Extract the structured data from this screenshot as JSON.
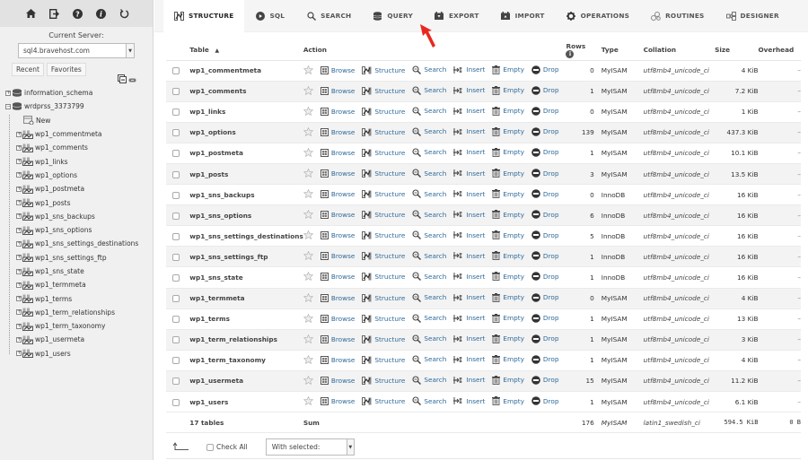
{
  "sidebar": {
    "top_icons": [
      "home-icon",
      "logout-icon",
      "help-icon",
      "info-icon",
      "reload-icon"
    ],
    "server_label": "Current Server:",
    "server_value": "sql4.bravehost.com",
    "recent_label": "Recent",
    "favorites_label": "Favorites",
    "databases": [
      {
        "name": "information_schema",
        "expanded": false
      },
      {
        "name": "wrdprss_3373799",
        "expanded": true
      }
    ],
    "new_label": "New",
    "tables": [
      "wp1_commentmeta",
      "wp1_comments",
      "wp1_links",
      "wp1_options",
      "wp1_postmeta",
      "wp1_posts",
      "wp1_sns_backups",
      "wp1_sns_options",
      "wp1_sns_settings_destinations",
      "wp1_sns_settings_ftp",
      "wp1_sns_state",
      "wp1_termmeta",
      "wp1_terms",
      "wp1_term_relationships",
      "wp1_term_taxonomy",
      "wp1_usermeta",
      "wp1_users"
    ]
  },
  "nav": {
    "tabs": [
      {
        "label": "STRUCTURE",
        "icon": "structure-icon",
        "active": true
      },
      {
        "label": "SQL",
        "icon": "sql-icon",
        "active": false
      },
      {
        "label": "SEARCH",
        "icon": "search-icon",
        "active": false
      },
      {
        "label": "QUERY",
        "icon": "query-icon",
        "active": false
      },
      {
        "label": "EXPORT",
        "icon": "export-icon",
        "active": false
      },
      {
        "label": "IMPORT",
        "icon": "import-icon",
        "active": false
      },
      {
        "label": "OPERATIONS",
        "icon": "gear-icon",
        "active": false
      },
      {
        "label": "ROUTINES",
        "icon": "routines-icon",
        "active": false
      },
      {
        "label": "DESIGNER",
        "icon": "designer-icon",
        "active": false
      }
    ]
  },
  "table": {
    "headers": {
      "table": "Table",
      "action": "Action",
      "rows": "Rows",
      "type": "Type",
      "collation": "Collation",
      "size": "Size",
      "overhead": "Overhead"
    },
    "actions": [
      "Browse",
      "Structure",
      "Search",
      "Insert",
      "Empty",
      "Drop"
    ],
    "rows": [
      {
        "name": "wp1_commentmeta",
        "rows": "0",
        "type": "MyISAM",
        "collation": "utf8mb4_unicode_ci",
        "size": "4 KiB",
        "overhead": "–"
      },
      {
        "name": "wp1_comments",
        "rows": "1",
        "type": "MyISAM",
        "collation": "utf8mb4_unicode_ci",
        "size": "7.2 KiB",
        "overhead": "–"
      },
      {
        "name": "wp1_links",
        "rows": "0",
        "type": "MyISAM",
        "collation": "utf8mb4_unicode_ci",
        "size": "1 KiB",
        "overhead": "–"
      },
      {
        "name": "wp1_options",
        "rows": "139",
        "type": "MyISAM",
        "collation": "utf8mb4_unicode_ci",
        "size": "437.3 KiB",
        "overhead": "–"
      },
      {
        "name": "wp1_postmeta",
        "rows": "1",
        "type": "MyISAM",
        "collation": "utf8mb4_unicode_ci",
        "size": "10.1 KiB",
        "overhead": "–"
      },
      {
        "name": "wp1_posts",
        "rows": "3",
        "type": "MyISAM",
        "collation": "utf8mb4_unicode_ci",
        "size": "13.5 KiB",
        "overhead": "–"
      },
      {
        "name": "wp1_sns_backups",
        "rows": "0",
        "type": "InnoDB",
        "collation": "utf8mb4_unicode_ci",
        "size": "16 KiB",
        "overhead": "–"
      },
      {
        "name": "wp1_sns_options",
        "rows": "6",
        "type": "InnoDB",
        "collation": "utf8mb4_unicode_ci",
        "size": "16 KiB",
        "overhead": "–"
      },
      {
        "name": "wp1_sns_settings_destinations",
        "rows": "5",
        "type": "InnoDB",
        "collation": "utf8mb4_unicode_ci",
        "size": "16 KiB",
        "overhead": "–"
      },
      {
        "name": "wp1_sns_settings_ftp",
        "rows": "1",
        "type": "InnoDB",
        "collation": "utf8mb4_unicode_ci",
        "size": "16 KiB",
        "overhead": "–"
      },
      {
        "name": "wp1_sns_state",
        "rows": "1",
        "type": "InnoDB",
        "collation": "utf8mb4_unicode_ci",
        "size": "16 KiB",
        "overhead": "–"
      },
      {
        "name": "wp1_termmeta",
        "rows": "0",
        "type": "MyISAM",
        "collation": "utf8mb4_unicode_ci",
        "size": "4 KiB",
        "overhead": "–"
      },
      {
        "name": "wp1_terms",
        "rows": "1",
        "type": "MyISAM",
        "collation": "utf8mb4_unicode_ci",
        "size": "13 KiB",
        "overhead": "–"
      },
      {
        "name": "wp1_term_relationships",
        "rows": "1",
        "type": "MyISAM",
        "collation": "utf8mb4_unicode_ci",
        "size": "3 KiB",
        "overhead": "–"
      },
      {
        "name": "wp1_term_taxonomy",
        "rows": "1",
        "type": "MyISAM",
        "collation": "utf8mb4_unicode_ci",
        "size": "4 KiB",
        "overhead": "–"
      },
      {
        "name": "wp1_usermeta",
        "rows": "15",
        "type": "MyISAM",
        "collation": "utf8mb4_unicode_ci",
        "size": "11.2 KiB",
        "overhead": "–"
      },
      {
        "name": "wp1_users",
        "rows": "1",
        "type": "MyISAM",
        "collation": "utf8mb4_unicode_ci",
        "size": "6.1 KiB",
        "overhead": "–"
      }
    ],
    "summary": {
      "count": "17 tables",
      "label": "Sum",
      "rows": "176",
      "type": "MyISAM",
      "collation": "latin1_swedish_ci",
      "size": "594.5 KiB",
      "overhead": "0 B"
    }
  },
  "footer": {
    "check_all_label": "Check All",
    "with_selected": "With selected:"
  },
  "colors": {
    "link": "#2f6a9a",
    "annotation_arrow": "#e8281e"
  }
}
